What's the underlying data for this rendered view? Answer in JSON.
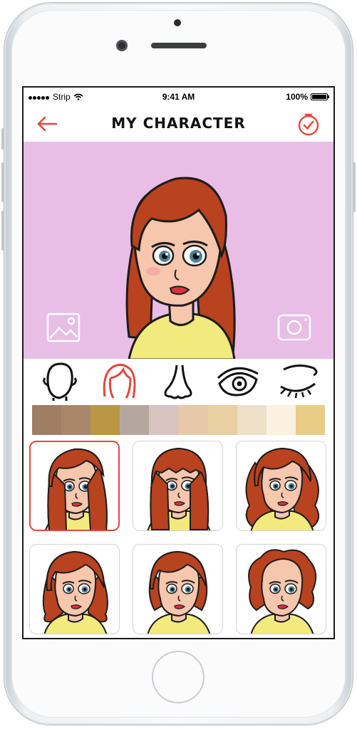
{
  "status_bar": {
    "carrier": "Strip",
    "time": "9:41 AM",
    "battery": "100%"
  },
  "nav": {
    "title": "MY CHARACTER",
    "back_icon": "arrow-left-icon",
    "done_icon": "checkmark-circle-icon"
  },
  "preview": {
    "gallery_icon": "image-icon",
    "camera_icon": "camera-icon"
  },
  "feature_tabs": [
    {
      "name": "face-shape",
      "icon": "head-outline-icon",
      "selected": false
    },
    {
      "name": "hair",
      "icon": "hair-icon",
      "selected": true
    },
    {
      "name": "nose",
      "icon": "nose-icon",
      "selected": false
    },
    {
      "name": "eyes",
      "icon": "eye-icon",
      "selected": false
    },
    {
      "name": "eyelashes",
      "icon": "closed-eye-icon",
      "selected": false
    }
  ],
  "swatches": [
    "#a07e63",
    "#a88769",
    "#b99744",
    "#b6a79e",
    "#d7c4c0",
    "#e7c8a9",
    "#e9cfa1",
    "#eee0c9",
    "#fbf1e0",
    "#e9cd86"
  ],
  "hair_options": [
    {
      "style": "long-side-part",
      "selected": true
    },
    {
      "style": "long-bangs",
      "selected": false
    },
    {
      "style": "long-wavy",
      "selected": false
    },
    {
      "style": "shoulder-flip",
      "selected": false
    },
    {
      "style": "bob",
      "selected": false
    },
    {
      "style": "short-curly",
      "selected": false
    }
  ],
  "colors": {
    "accent": "#e0483d",
    "preview_bg": "#e8bde6",
    "hair": "#b9421f",
    "shirt": "#f2ea7c"
  }
}
